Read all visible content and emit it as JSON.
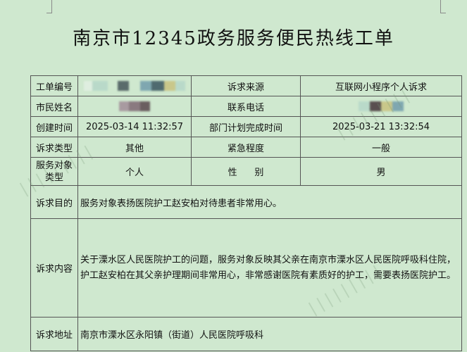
{
  "title": "南京市12345政务服务便民热线工单",
  "rows": {
    "ticket_no": {
      "label": "工单编号",
      "source_label": "诉求来源",
      "source_value": "互联网小程序个人诉求"
    },
    "citizen": {
      "label": "市民姓名",
      "phone_label": "联系电话"
    },
    "created": {
      "label": "创建时间",
      "value": "2025-03-14 11:32:57",
      "plan_label": "部门计划完成时间",
      "plan_value": "2025-03-21 13:32:54"
    },
    "type": {
      "label": "诉求类型",
      "value": "其他",
      "urgency_label": "紧急程度",
      "urgency_value": "一般"
    },
    "target": {
      "label": "服务对象类型",
      "value": "个人",
      "gender_label": "性      别",
      "gender_value": "男"
    },
    "purpose": {
      "label": "诉求目的",
      "value": "服务对象表扬医院护工赵安柏对待患者非常用心。"
    },
    "content": {
      "label": "诉求内容",
      "value": "关于溧水区人民医院护工的问题，服务对象反映其父亲在南京市溧水区人民医院呼吸科住院，护工赵安柏在其父亲护理期间非常用心，非常感谢医院有素质好的护工，需要表扬医院护工。"
    },
    "address": {
      "label": "诉求地址",
      "value": "南京市溧水区永阳镇（街道）人民医院呼吸科"
    }
  },
  "redaction_colors": [
    "#b9d9c9",
    "#5a6b6b",
    "#7fa7b0",
    "#c9c78a",
    "#8a7a80"
  ]
}
